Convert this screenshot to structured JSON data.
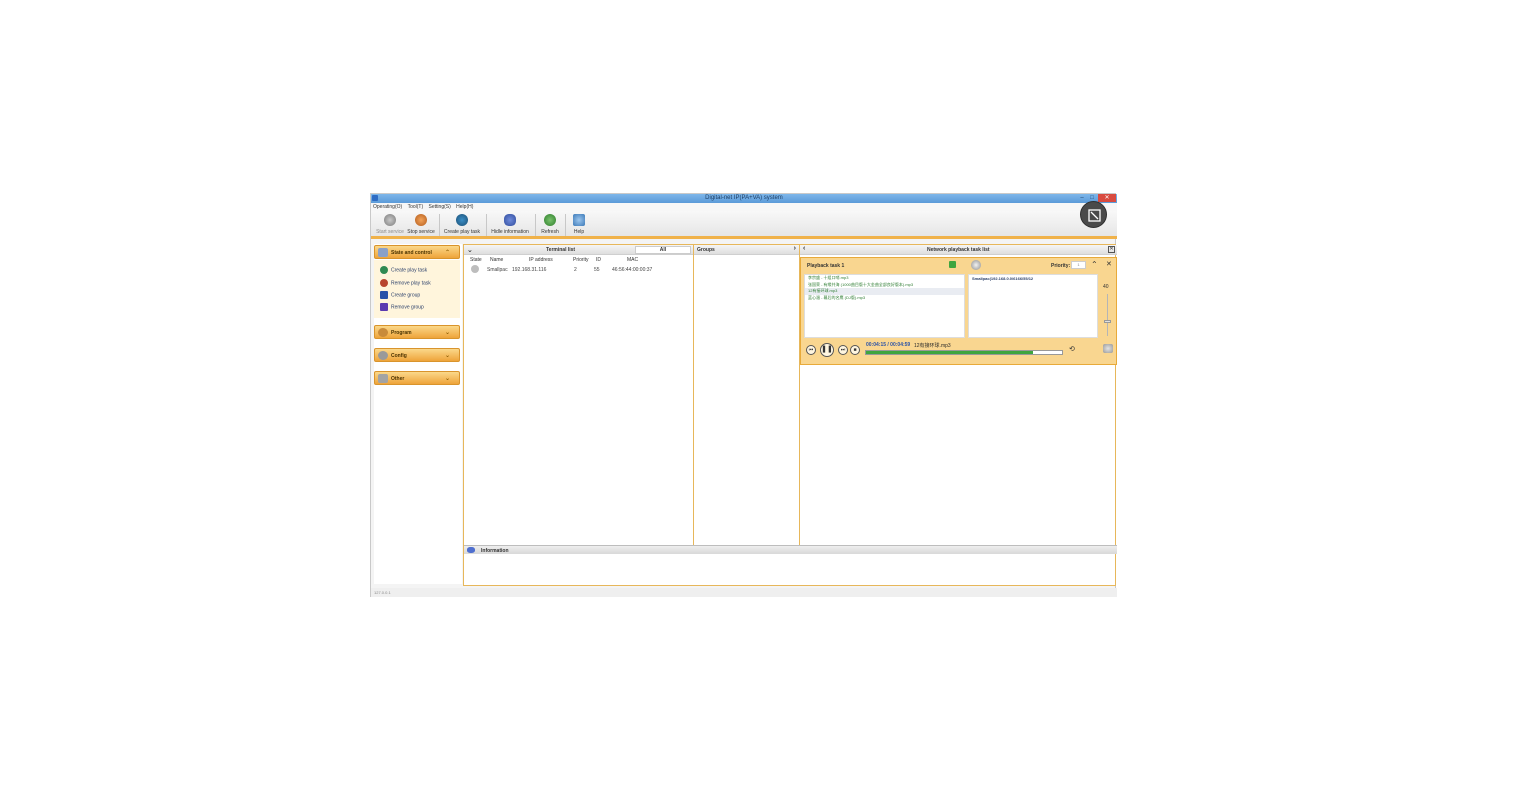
{
  "window": {
    "title": "Digital-net IP(PA+VA) system",
    "min": "–",
    "max": "□",
    "close": "✕"
  },
  "menu": [
    "Operating(O)",
    "Tool(T)",
    "Setting(S)",
    "Help(H)"
  ],
  "toolbar": {
    "start_service": "Start service",
    "stop_service": "Stop service",
    "create_play_task": "Create play task",
    "hide_information": "Hidle information",
    "refresh": "Refresh",
    "help": "Help"
  },
  "sidebar": {
    "state_control": "State and control",
    "items": [
      "Create play task",
      "Remove play task",
      "Create group",
      "Remove group"
    ],
    "program": "Program",
    "config": "Config",
    "other": "Other"
  },
  "terminal": {
    "title": "Terminal list",
    "filter": "All",
    "columns": [
      "State",
      "Name",
      "IP address",
      "Priority",
      "ID",
      "MAC"
    ],
    "rows": [
      {
        "name": "Smallpac",
        "ip": "192.168.31.116",
        "priority": "2",
        "id": "55",
        "mac": "46:56:44:00:00:37"
      }
    ]
  },
  "groups": {
    "title": "Groups"
  },
  "network": {
    "title": "Network playback task list",
    "task": {
      "name": "Playback task 1",
      "priority_label": "Priority:",
      "priority_value": "1",
      "songs": [
        "李宗盛 - 十组口哨.mp3",
        "张国荣 - 有缘共海 (1000曲目版十大金曲全部良好版本).mp3",
        "12有接环球.mp3",
        "蓝心湄 - 幕后的名鹰 (DJ版).mp3"
      ],
      "target": "Smallpac(192.168.0.0/6166/55/12",
      "time": "00:04:15 / 00:04:59",
      "current_song": "12有接环球.mp3",
      "volume": "40",
      "progress": 0.85
    }
  },
  "information": {
    "title": "Information"
  },
  "status": {
    "text": "127.0.0.1"
  },
  "colors": {
    "accent": "#f0b24a",
    "title_blue": "#5b9ad8",
    "progress_green": "#3fa53f"
  }
}
